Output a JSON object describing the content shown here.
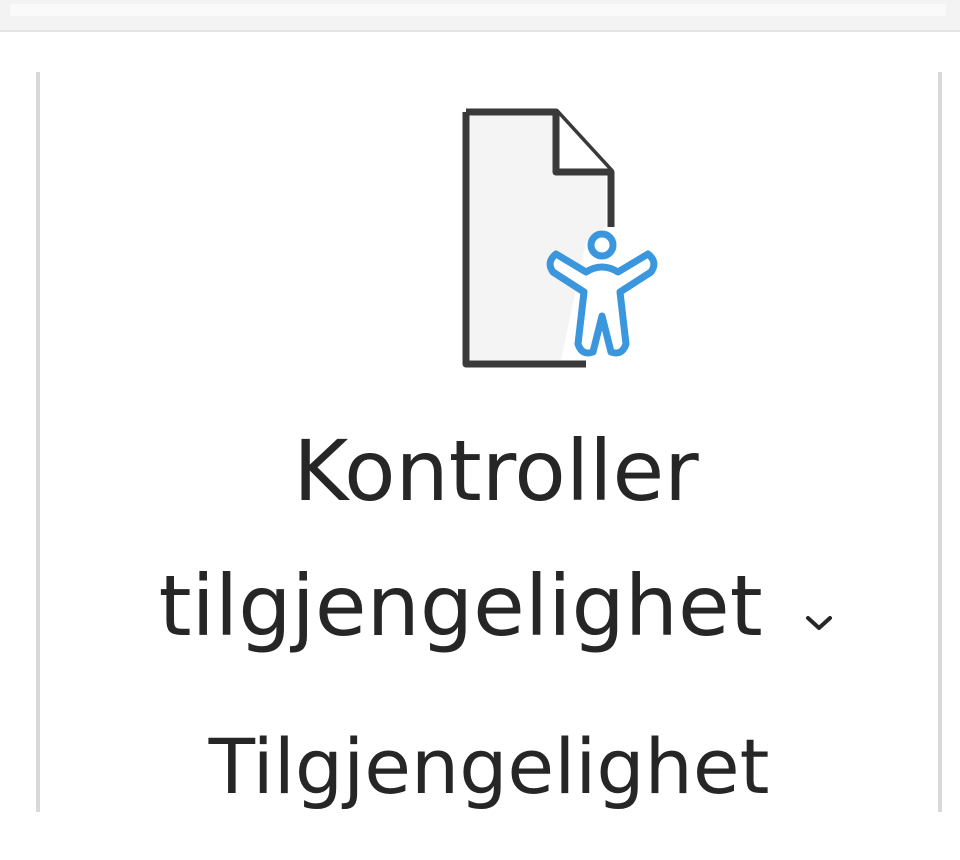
{
  "ribbon": {
    "button": {
      "label_line1": "Kontroller",
      "label_line2": "tilgjengelighet",
      "icon": "document-accessibility-icon",
      "dropdown_icon": "chevron-down-icon"
    },
    "group_label": "Tilgjengelighet"
  },
  "colors": {
    "text": "#262626",
    "icon_outline": "#3a3a3a",
    "accent": "#3a96dd",
    "separator": "#d9d9d9"
  }
}
